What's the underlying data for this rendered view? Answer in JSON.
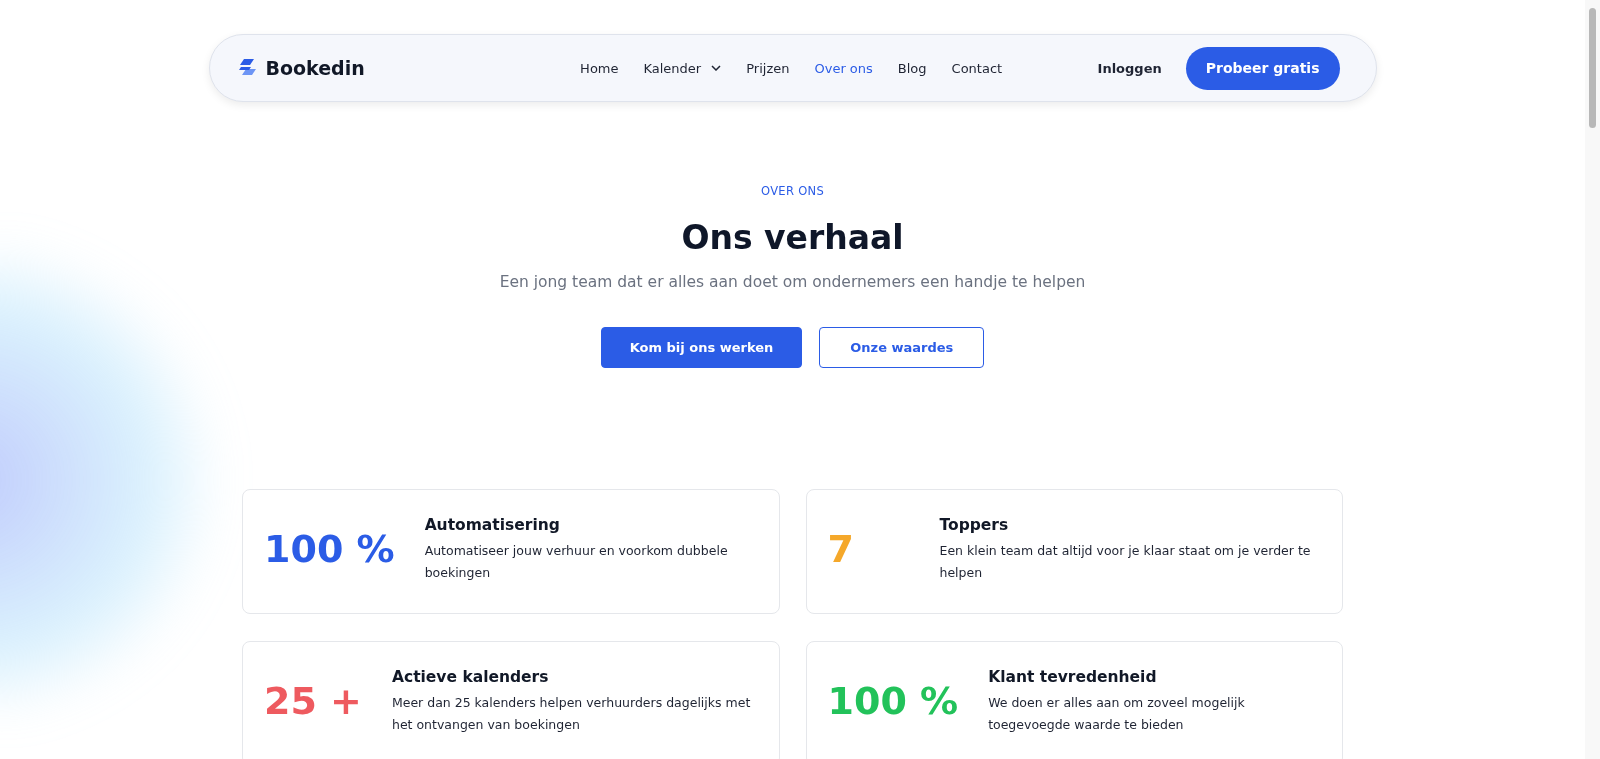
{
  "header": {
    "logo": "Bookedin",
    "nav": [
      {
        "label": "Home",
        "selected": false,
        "dropdown": false
      },
      {
        "label": "Kalender",
        "selected": false,
        "dropdown": true
      },
      {
        "label": "Prijzen",
        "selected": false,
        "dropdown": false
      },
      {
        "label": "Over ons",
        "selected": true,
        "dropdown": false
      },
      {
        "label": "Blog",
        "selected": false,
        "dropdown": false
      },
      {
        "label": "Contact",
        "selected": false,
        "dropdown": false
      }
    ],
    "login": "Inloggen",
    "cta": "Probeer gratis"
  },
  "hero": {
    "eyebrow": "OVER ONS",
    "title": "Ons verhaal",
    "subtitle": "Een jong team dat er alles aan doet om ondernemers een handje te helpen",
    "buttons": [
      {
        "label": "Kom bij ons werken",
        "kind": "primary"
      },
      {
        "label": "Onze waardes",
        "kind": "outline"
      }
    ]
  },
  "stats": [
    {
      "value": "100 %",
      "color": "#2b5ce6",
      "title": "Automatisering",
      "text": "Automatiseer jouw verhuur en voorkom dubbele boekingen"
    },
    {
      "value": "7",
      "color": "#f5a82a",
      "title": "Toppers",
      "text": "Een klein team dat altijd voor je klaar staat om je verder te helpen"
    },
    {
      "value": "25 +",
      "color": "#ee5a5f",
      "title": "Actieve kalenders",
      "text": "Meer dan 25 kalenders helpen verhuurders dagelijks met het ontvangen van boekingen"
    },
    {
      "value": "100 %",
      "color": "#22c25a",
      "title": "Klant tevredenheid",
      "text": "We doen er alles aan om zoveel mogelijk toegevoegde waarde te bieden"
    }
  ]
}
